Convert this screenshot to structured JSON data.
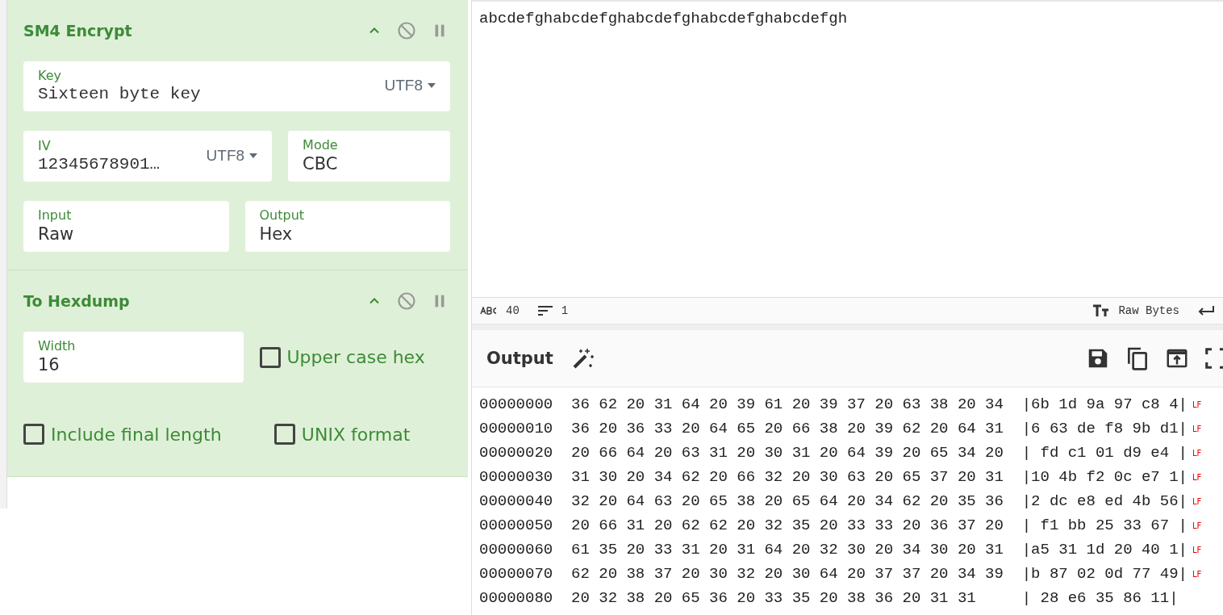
{
  "recipe": [
    {
      "title": "SM4 Encrypt",
      "rows": [
        [
          {
            "kind": "text_enc",
            "label": "Key",
            "value": "Sixteen byte key",
            "encoding": "UTF8"
          }
        ],
        [
          {
            "kind": "text_enc",
            "label": "IV",
            "value": "12345678901…",
            "encoding": "UTF8"
          },
          {
            "kind": "select",
            "label": "Mode",
            "value": "CBC"
          }
        ],
        [
          {
            "kind": "select",
            "label": "Input",
            "value": "Raw"
          },
          {
            "kind": "select",
            "label": "Output",
            "value": "Hex"
          }
        ]
      ]
    },
    {
      "title": "To Hexdump",
      "rows": [
        [
          {
            "kind": "number",
            "label": "Width",
            "value": "16"
          },
          {
            "kind": "checkbox",
            "label": "Upper case hex",
            "checked": false
          }
        ],
        [
          {
            "kind": "checkbox",
            "label": "Include final length",
            "checked": false
          },
          {
            "kind": "checkbox",
            "label": "UNIX format",
            "checked": false
          }
        ]
      ]
    }
  ],
  "input": {
    "text": "abcdefghabcdefghabcdefghabcdefghabcdefgh",
    "status": {
      "length": "40",
      "lines": "1",
      "encoding": "Raw Bytes"
    }
  },
  "output": {
    "title": "Output",
    "lines": [
      {
        "text": "00000000  36 62 20 31 64 20 39 61 20 39 37 20 63 38 20 34  |6b 1d 9a 97 c8 4|",
        "eol": "LF"
      },
      {
        "text": "00000010  36 20 36 33 20 64 65 20 66 38 20 39 62 20 64 31  |6 63 de f8 9b d1|",
        "eol": "LF"
      },
      {
        "text": "00000020  20 66 64 20 63 31 20 30 31 20 64 39 20 65 34 20  | fd c1 01 d9 e4 |",
        "eol": "LF"
      },
      {
        "text": "00000030  31 30 20 34 62 20 66 32 20 30 63 20 65 37 20 31  |10 4b f2 0c e7 1|",
        "eol": "LF"
      },
      {
        "text": "00000040  32 20 64 63 20 65 38 20 65 64 20 34 62 20 35 36  |2 dc e8 ed 4b 56|",
        "eol": "LF"
      },
      {
        "text": "00000050  20 66 31 20 62 62 20 32 35 20 33 33 20 36 37 20  | f1 bb 25 33 67 |",
        "eol": "LF"
      },
      {
        "text": "00000060  61 35 20 33 31 20 31 64 20 32 30 20 34 30 20 31  |a5 31 1d 20 40 1|",
        "eol": "LF"
      },
      {
        "text": "00000070  62 20 38 37 20 30 32 20 30 64 20 37 37 20 34 39  |b 87 02 0d 77 49|",
        "eol": "LF"
      },
      {
        "text": "00000080  20 32 38 20 65 36 20 33 35 20 38 36 20 31 31     | 28 e6 35 86 11|"
      }
    ]
  }
}
